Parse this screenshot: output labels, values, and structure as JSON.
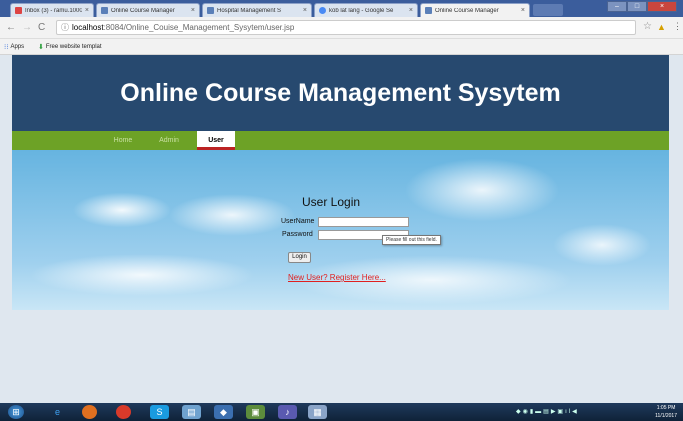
{
  "browser": {
    "tabs": [
      {
        "title": "Inbox (3) - ramu.1000p",
        "favicon_color": "#d44"
      },
      {
        "title": "Online Course Manager",
        "favicon_color": "#5a7fb8"
      },
      {
        "title": "Hospital Management S",
        "favicon_color": "#5a7fb8"
      },
      {
        "title": "kob lat lang - Google Se",
        "favicon_color": "#4a8af4"
      },
      {
        "title": "Online Course Manager",
        "favicon_color": "#5a7fb8"
      }
    ],
    "address": {
      "info_icon": "info-icon",
      "host": "localhost",
      "path": ":8084/Online_Couise_Management_Sysytem/user.jsp"
    },
    "bookmarks": [
      {
        "label": "Apps",
        "icon": "apps-grid-icon"
      },
      {
        "label": "Free website templat",
        "icon": "bookmark-arrow-icon"
      }
    ]
  },
  "site": {
    "title": "Online Course Management Sysytem",
    "menu": [
      {
        "label": "Home"
      },
      {
        "label": "Admin"
      },
      {
        "label": "User"
      }
    ]
  },
  "login": {
    "heading": "User Login",
    "username_label": "UserName",
    "password_label": "Password",
    "username_value": "",
    "password_value": "",
    "tooltip": "Please fill out this field.",
    "button": "Login",
    "register_link": "New User? Register Here..."
  },
  "taskbar": {
    "time": "1:05 PM",
    "date": "11/1/2017"
  },
  "colors": {
    "header": "#27496f",
    "menu": "#6da226",
    "link": "#e02020"
  }
}
